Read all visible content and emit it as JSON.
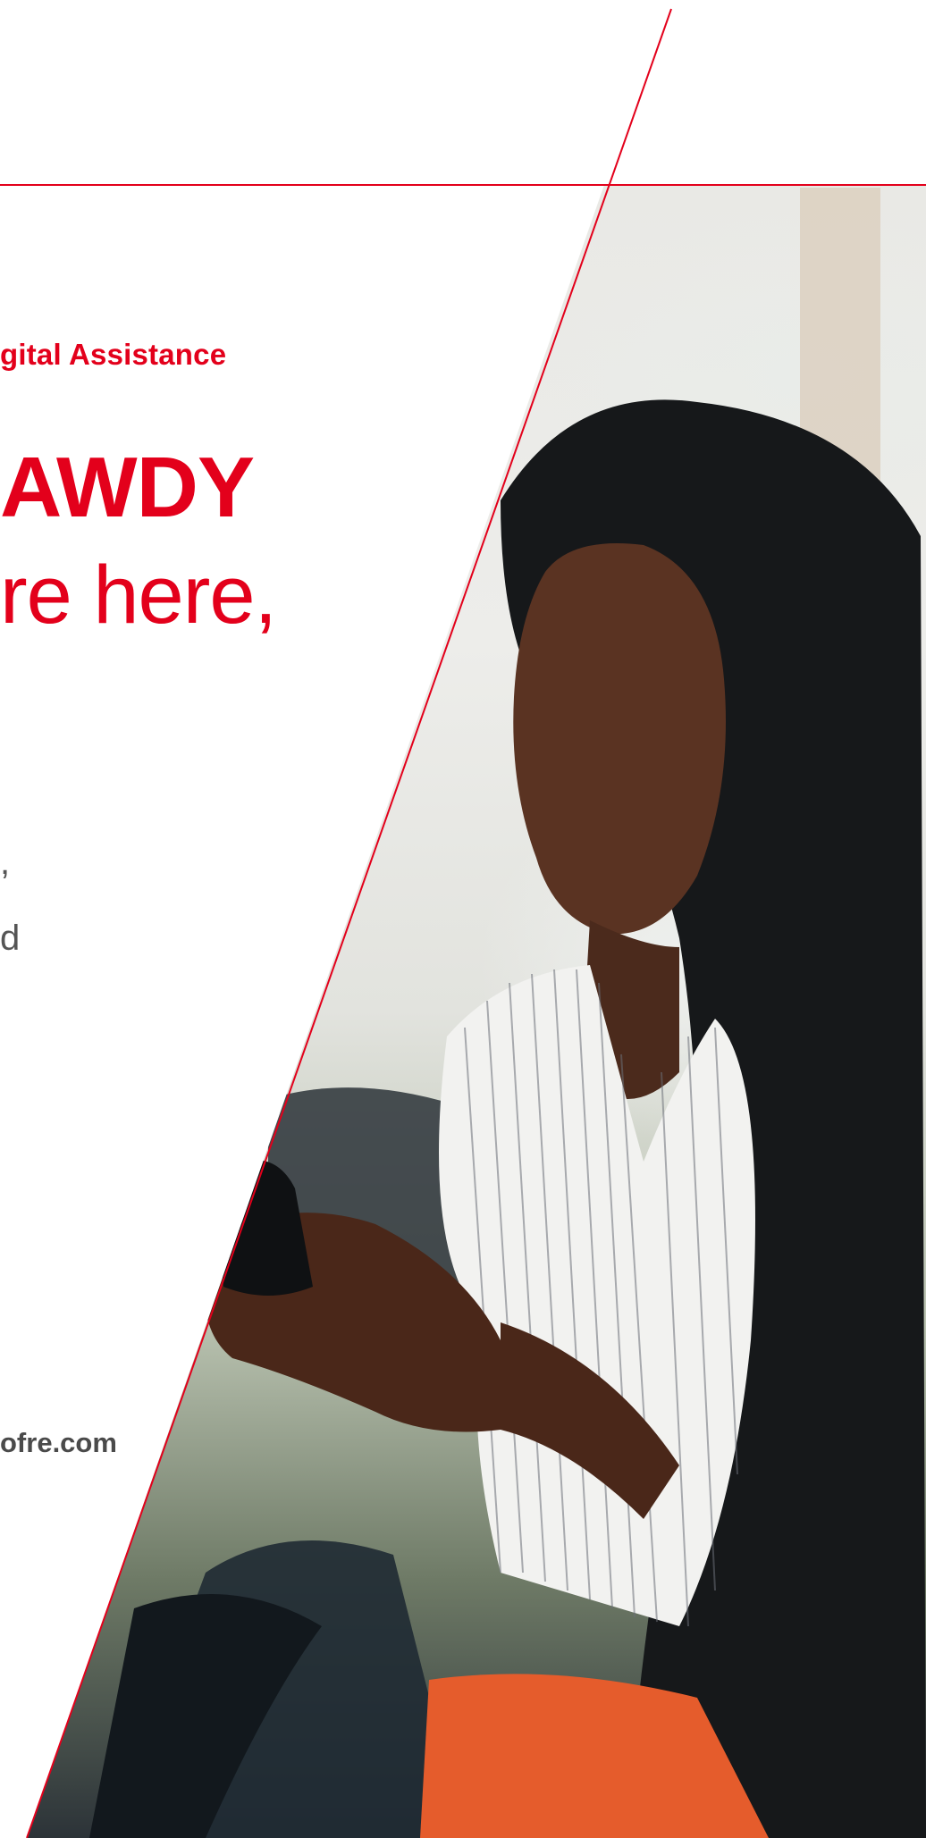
{
  "header": {
    "brand_line": "gital Assistance"
  },
  "headline": {
    "bold": "AWDY",
    "light": "re here,"
  },
  "body": {
    "fragment_1": ",",
    "fragment_2": "d"
  },
  "footer": {
    "url": "ofre.com"
  },
  "photo": {
    "icon": "woman-with-phone-photo"
  },
  "colors": {
    "accent": "#e3001b",
    "text_gray": "#555555"
  }
}
